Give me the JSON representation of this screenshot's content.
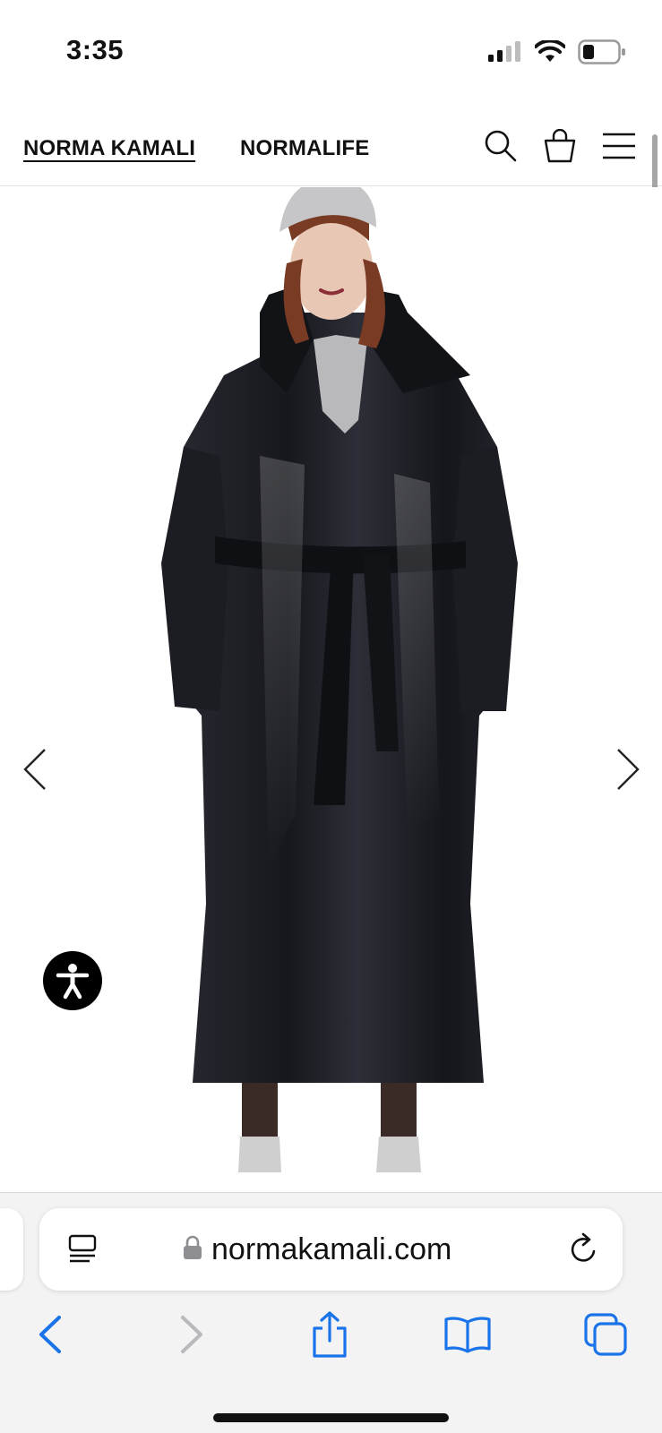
{
  "status_bar": {
    "time": "3:35",
    "icons": [
      "cellular-signal-icon",
      "wifi-icon",
      "battery-icon"
    ],
    "battery_level": 0.3
  },
  "header": {
    "nav": [
      {
        "label": "NORMA KAMALI",
        "active": true
      },
      {
        "label": "NORMALIFE",
        "active": false
      }
    ],
    "icons": [
      "search-icon",
      "shopping-bag-icon",
      "hamburger-menu-icon"
    ]
  },
  "product": {
    "image": "model-wearing-black-puffer-sleeping-bag-coat",
    "carousel_icons": [
      "chevron-left-icon",
      "chevron-right-icon"
    ],
    "accessibility_icon": "accessibility-icon"
  },
  "browser": {
    "url": "normakamali.com",
    "icons": {
      "reader": "reader-view-icon",
      "lock": "lock-icon",
      "reload": "reload-icon",
      "back": "back-arrow-icon",
      "forward": "forward-arrow-icon",
      "share": "share-icon",
      "bookmarks": "bookmarks-book-icon",
      "tabs": "tabs-icon"
    }
  },
  "colors": {
    "safari_blue": "#1a73e8",
    "coat_black": "#1b1c22",
    "toolbar_bg": "#f3f3f4"
  }
}
